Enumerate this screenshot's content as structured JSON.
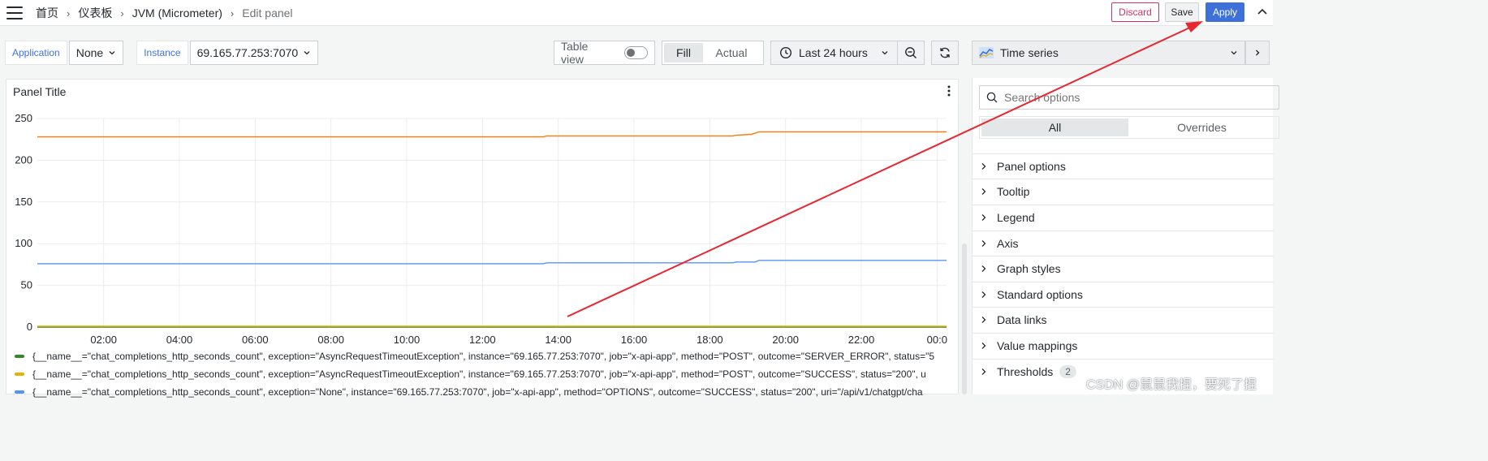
{
  "header": {
    "breadcrumbs": [
      "首页",
      "仪表板",
      "JVM (Micrometer)",
      "Edit panel"
    ],
    "discard_label": "Discard",
    "save_label": "Save",
    "apply_label": "Apply"
  },
  "variables": {
    "application_label": "Application",
    "application_value": "None",
    "instance_label": "Instance",
    "instance_value": "69.165.77.253:7070"
  },
  "toolbar": {
    "table_view_label": "Table view",
    "fill_label": "Fill",
    "actual_label": "Actual",
    "time_range": "Last 24 hours"
  },
  "panel": {
    "title": "Panel Title"
  },
  "chart_data": {
    "type": "line",
    "y_ticks": [
      "250",
      "200",
      "150",
      "100",
      "50",
      "0"
    ],
    "x_ticks": [
      "02:00",
      "04:00",
      "06:00",
      "08:00",
      "10:00",
      "12:00",
      "14:00",
      "16:00",
      "18:00",
      "20:00",
      "22:00",
      "00:0"
    ],
    "ylim": [
      0,
      250
    ],
    "xlim_hours": [
      0.25,
      24.25
    ],
    "grid": true,
    "series": [
      {
        "name": "{__name__=\"chat_completions_http_seconds_count\", exception=\"AsyncRequestTimeoutException\", instance=\"69.165.77.253:7070\", job=\"x-api-app\", method=\"POST\", outcome=\"SERVER_ERROR\", status=\"5",
        "color": "#37872d",
        "x": [
          0.25,
          24.25
        ],
        "y": [
          0,
          0
        ]
      },
      {
        "name": "{__name__=\"chat_completions_http_seconds_count\", exception=\"AsyncRequestTimeoutException\", instance=\"69.165.77.253:7070\", job=\"x-api-app\", method=\"POST\", outcome=\"SUCCESS\", status=\"200\", u",
        "color": "#e0b400",
        "x": [
          0.25,
          24.25
        ],
        "y": [
          1,
          1
        ]
      },
      {
        "name": "{__name__=\"chat_completions_http_seconds_count\", exception=\"None\", instance=\"69.165.77.253:7070\", job=\"x-api-app\", method=\"OPTIONS\", outcome=\"SUCCESS\", status=\"200\", uri=\"/api/v1/chatgpt/cha",
        "color": "#5794f2",
        "x": [
          0.25,
          13.6,
          13.7,
          18.6,
          18.7,
          19.2,
          19.3,
          24.25
        ],
        "y": [
          76,
          76,
          77,
          77,
          78,
          78,
          80,
          80
        ]
      },
      {
        "name": "",
        "color": "#ff780a",
        "x": [
          0.25,
          13.6,
          13.7,
          18.6,
          18.7,
          19.1,
          19.3,
          24.25
        ],
        "y": [
          228,
          228,
          229,
          229,
          230,
          231,
          234,
          234
        ]
      }
    ]
  },
  "options": {
    "viz_name": "Time series",
    "search_placeholder": "Search options",
    "tab_all": "All",
    "tab_overrides": "Overrides",
    "sections": [
      "Panel options",
      "Tooltip",
      "Legend",
      "Axis",
      "Graph styles",
      "Standard options",
      "Data links",
      "Value mappings",
      "Thresholds"
    ],
    "thresholds_count": "2"
  },
  "watermark": "CSDN @鼠鼠我捏，要死了捏",
  "colors": {
    "accent": "#3d71d9",
    "discard": "#d9325e",
    "annotation_arrow": "#e8262f"
  }
}
